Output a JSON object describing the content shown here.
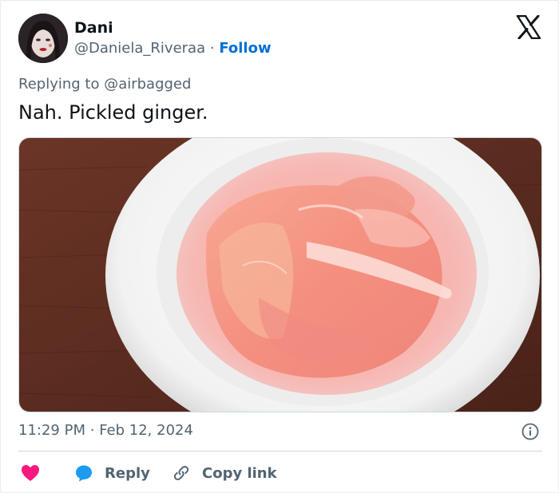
{
  "author": {
    "name": "Dani",
    "handle": "@Daniela_Riveraa",
    "separator": "·",
    "follow_label": "Follow"
  },
  "brand_icon": "x-logo-icon",
  "tweet": {
    "replying_to_prefix": "Replying to ",
    "replying_to_handle": "@airbagged",
    "text": "Nah. Pickled ginger.",
    "time": "11:29 PM",
    "date_separator": "·",
    "date": "Feb 12, 2024"
  },
  "media": {
    "icon": "photo-pickled-ginger-bowl"
  },
  "actions": {
    "like_icon": "heart-icon",
    "reply_label": "Reply",
    "copy_label": "Copy link"
  },
  "colors": {
    "link_blue": "#006fd6",
    "like_pink": "#f91880",
    "reply_blue": "#1d9bf0",
    "muted": "#536471",
    "text": "#0f1419"
  }
}
